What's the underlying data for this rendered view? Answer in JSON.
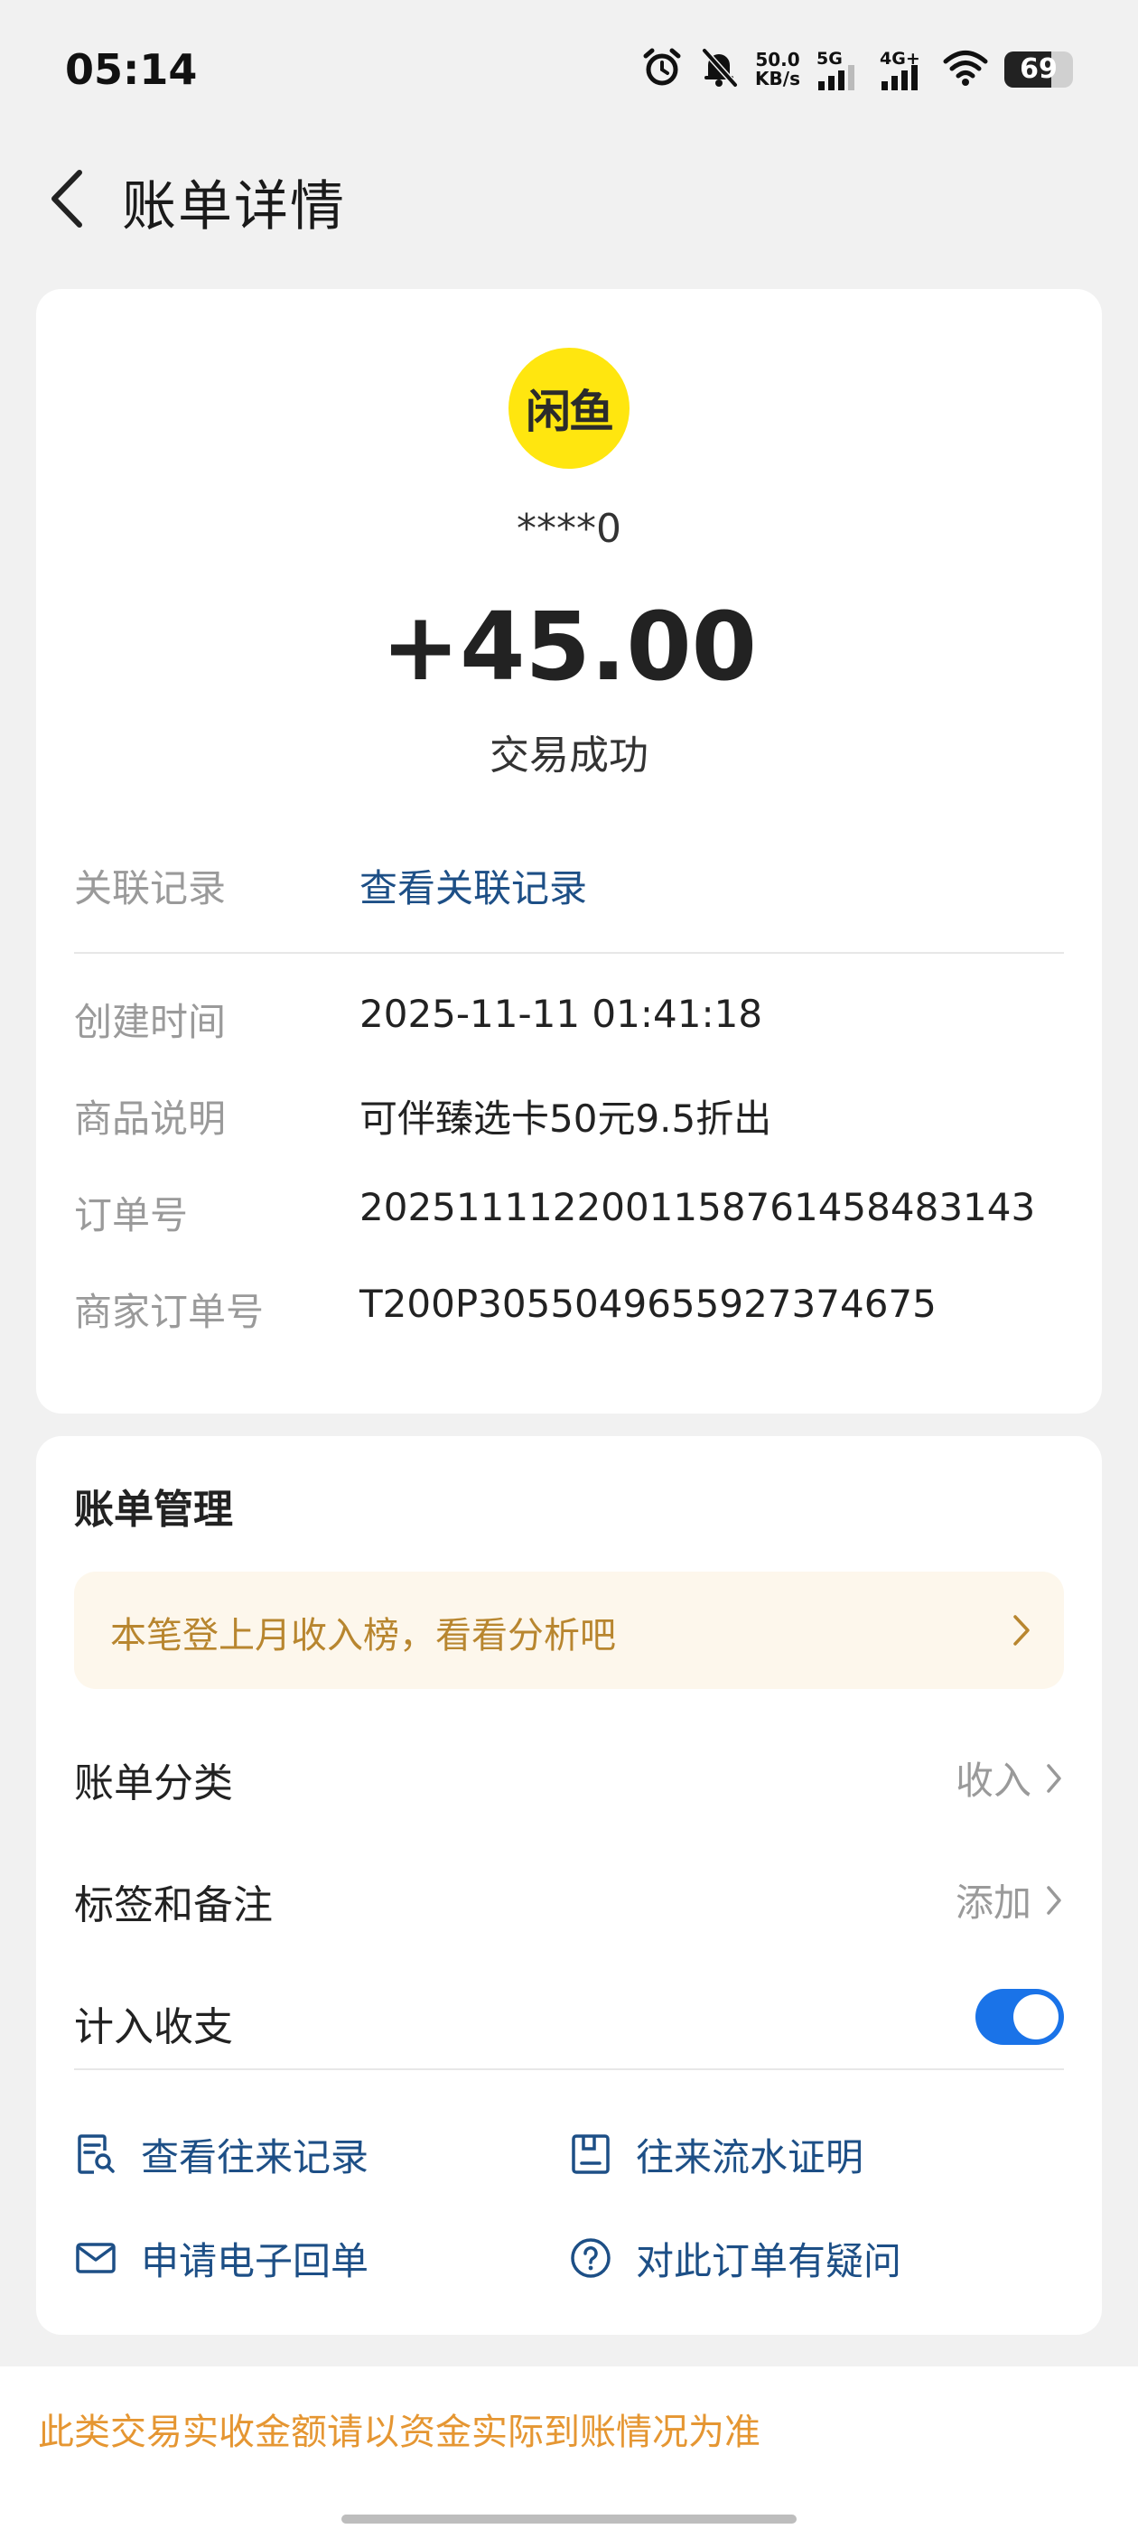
{
  "status_bar": {
    "time": "05:14",
    "speed_value": "50.0",
    "speed_unit": "KB/s",
    "net1": "5G",
    "net2": "4G+",
    "battery": "69",
    "icons": [
      "alarm-icon",
      "bell-off-icon",
      "wifi-icon"
    ]
  },
  "header": {
    "title": "账单详情"
  },
  "transaction": {
    "merchant_logo_text": "闲鱼",
    "account": "****0",
    "amount": "+45.00",
    "status": "交易成功",
    "related": {
      "label": "关联记录",
      "value": "查看关联记录"
    },
    "details": [
      {
        "label": "创建时间",
        "value": "2025-11-11 01:41:18"
      },
      {
        "label": "商品说明",
        "value": "可伴臻选卡50元9.5折出"
      },
      {
        "label": "订单号",
        "value": "2025111122001158761458483143"
      },
      {
        "label": "商家订单号",
        "value": "T200P3055049655927374675"
      }
    ]
  },
  "manage": {
    "title": "账单管理",
    "promo": "本笔登上月收入榜，看看分析吧",
    "category": {
      "label": "账单分类",
      "value": "收入"
    },
    "tags": {
      "label": "标签和备注",
      "value": "添加"
    },
    "include": {
      "label": "计入收支",
      "enabled": true
    },
    "actions": [
      {
        "label": "查看往来记录",
        "icon": "record-search-icon"
      },
      {
        "label": "往来流水证明",
        "icon": "statement-icon"
      },
      {
        "label": "申请电子回单",
        "icon": "mail-icon"
      },
      {
        "label": "对此订单有疑问",
        "icon": "question-icon"
      }
    ]
  },
  "footer": {
    "notice": "此类交易实收金额请以资金实际到账情况为准"
  },
  "colors": {
    "link": "#1d4f86",
    "accent": "#1a73e8",
    "promo_text": "#b8862f",
    "notice": "#e59632",
    "logo_bg": "#ffe60f"
  }
}
